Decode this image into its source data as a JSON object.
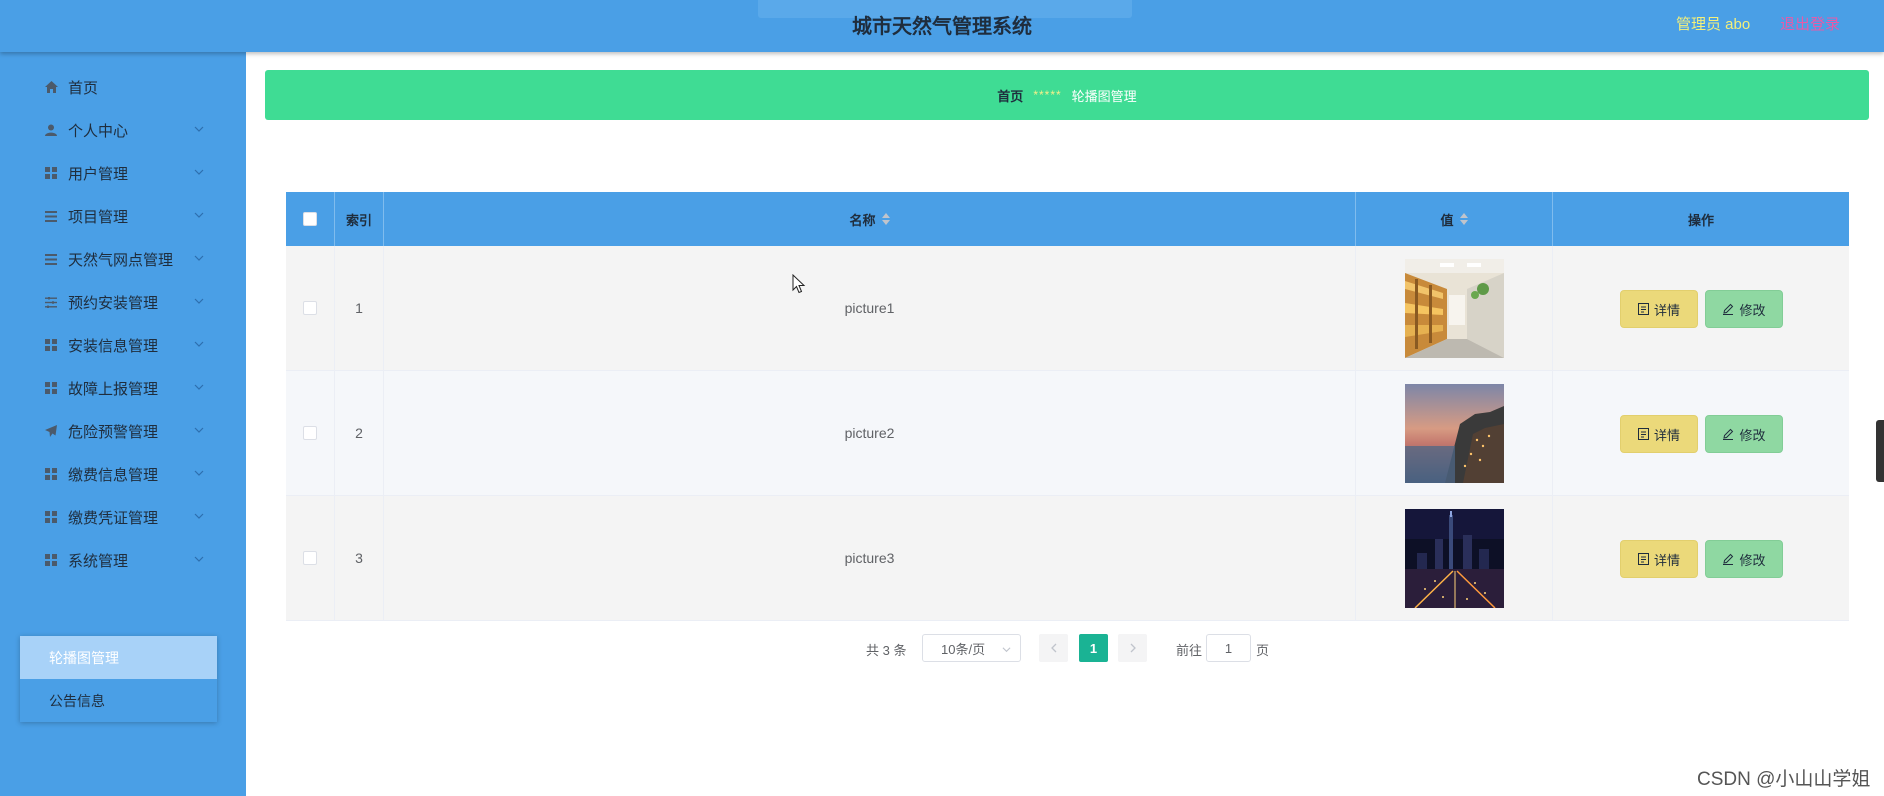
{
  "header": {
    "title": "城市天然气管理系统",
    "user_label": "管理员 abo",
    "logout_label": "退出登录"
  },
  "sidebar": {
    "items": [
      {
        "label": "首页",
        "icon": "home-icon"
      },
      {
        "label": "个人中心",
        "icon": "user-icon"
      },
      {
        "label": "用户管理",
        "icon": "grid-icon"
      },
      {
        "label": "项目管理",
        "icon": "list-icon"
      },
      {
        "label": "天然气网点管理",
        "icon": "list-icon"
      },
      {
        "label": "预约安装管理",
        "icon": "sliders-icon"
      },
      {
        "label": "安装信息管理",
        "icon": "grid-icon"
      },
      {
        "label": "故障上报管理",
        "icon": "grid-icon"
      },
      {
        "label": "危险预警管理",
        "icon": "send-icon"
      },
      {
        "label": "缴费信息管理",
        "icon": "grid-icon"
      },
      {
        "label": "缴费凭证管理",
        "icon": "grid-icon"
      },
      {
        "label": "系统管理",
        "icon": "grid-icon"
      }
    ],
    "submenu": [
      {
        "label": "轮播图管理",
        "active": true
      },
      {
        "label": "公告信息",
        "active": false
      }
    ]
  },
  "breadcrumb": {
    "home": "首页",
    "separator": "*****",
    "current": "轮播图管理"
  },
  "table": {
    "headers": {
      "index": "索引",
      "name": "名称",
      "value": "值",
      "actions": "操作"
    },
    "rows": [
      {
        "index": "1",
        "name": "picture1",
        "image": "library-photo"
      },
      {
        "index": "2",
        "name": "picture2",
        "image": "coastal-sunset-photo"
      },
      {
        "index": "3",
        "name": "picture3",
        "image": "night-city-photo"
      }
    ],
    "detail_label": "详情",
    "edit_label": "修改"
  },
  "pagination": {
    "total": "共 3 条",
    "page_size": "10条/页",
    "current_page": "1",
    "goto_label": "前往",
    "goto_value": "1",
    "page_suffix": "页"
  },
  "watermark": "CSDN @小山山学姐",
  "colors": {
    "header_bg": "#4a9fe6",
    "breadcrumb_bg": "#3fdc94",
    "detail_button": "#ebd97a",
    "edit_button": "#8fd8a2",
    "pager_active": "#1ab394"
  }
}
